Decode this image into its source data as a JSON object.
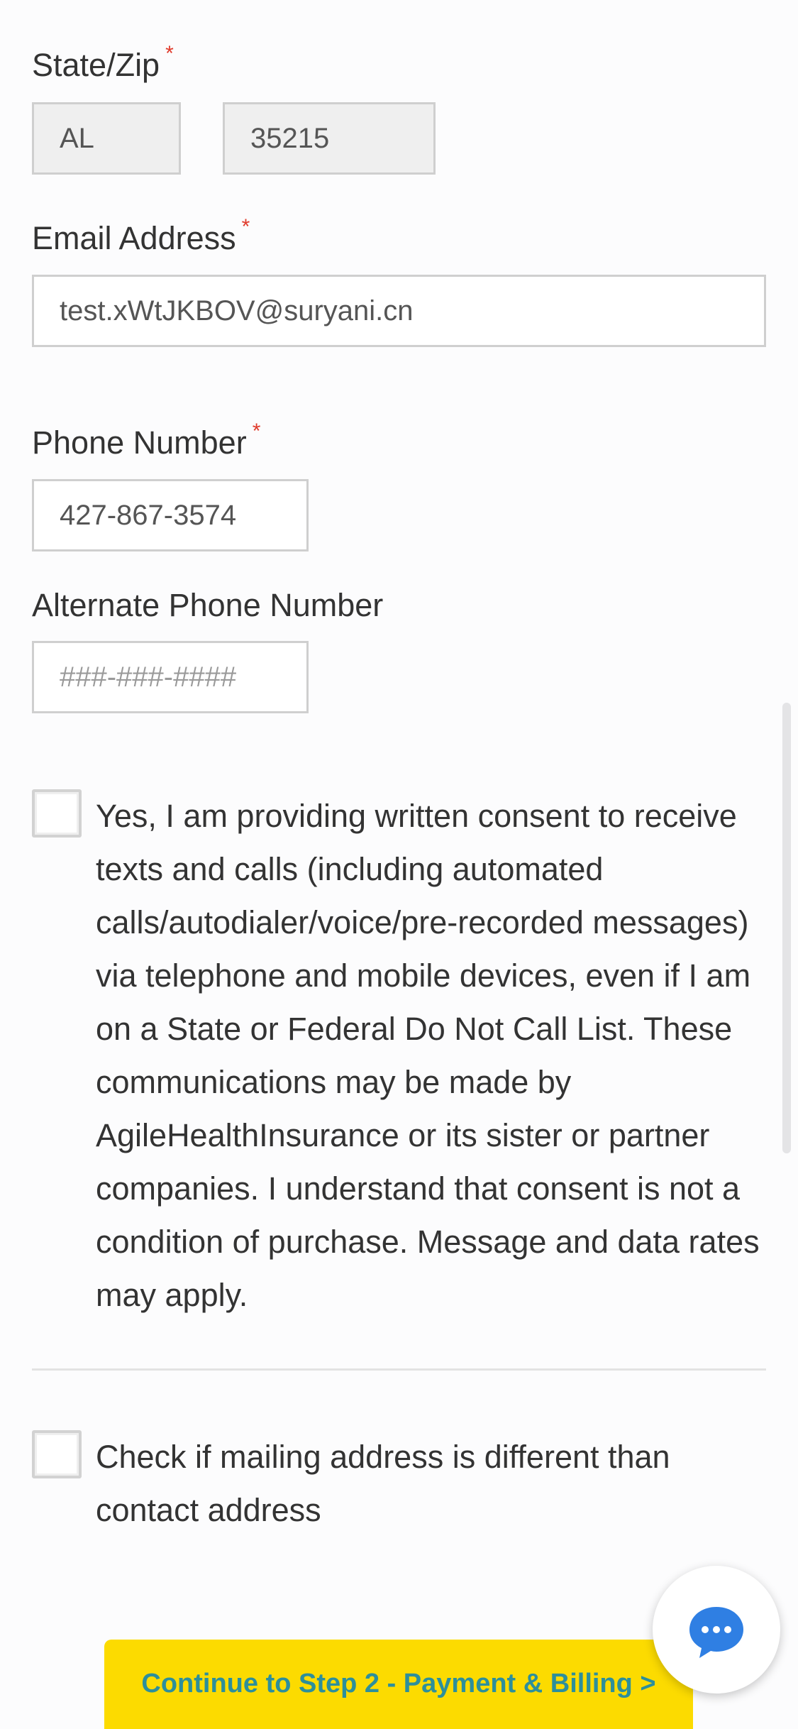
{
  "state_zip": {
    "label": "State/Zip",
    "required_mark": "*",
    "state_value": "AL",
    "zip_value": "35215"
  },
  "email": {
    "label": "Email Address",
    "required_mark": "*",
    "value": "test.xWtJKBOV@suryani.cn"
  },
  "phone": {
    "label": "Phone Number",
    "required_mark": "*",
    "value": "427-867-3574"
  },
  "alt_phone": {
    "label": "Alternate Phone Number",
    "placeholder": "###-###-####"
  },
  "consent": {
    "checked": false,
    "text": "Yes, I am providing written consent to receive texts and calls (including automated calls/autodialer/voice/pre-recorded messages) via telephone and mobile devices, even if I am on a State or Federal Do Not Call List. These communications may be made by AgileHealthInsurance or its sister or partner companies. I understand that consent is not a condition of purchase. Message and data rates may apply."
  },
  "mailing": {
    "checked": false,
    "text": "Check if mailing address is different than contact address"
  },
  "cta": {
    "label": "Continue to Step 2 - Payment & Billing >"
  },
  "chat": {
    "icon": "chat-bubble-icon"
  },
  "colors": {
    "required": "#e03b2c",
    "cta_background": "#fcdb00",
    "cta_text": "#2d8f9b",
    "chat_icon": "#2f7fe3"
  }
}
